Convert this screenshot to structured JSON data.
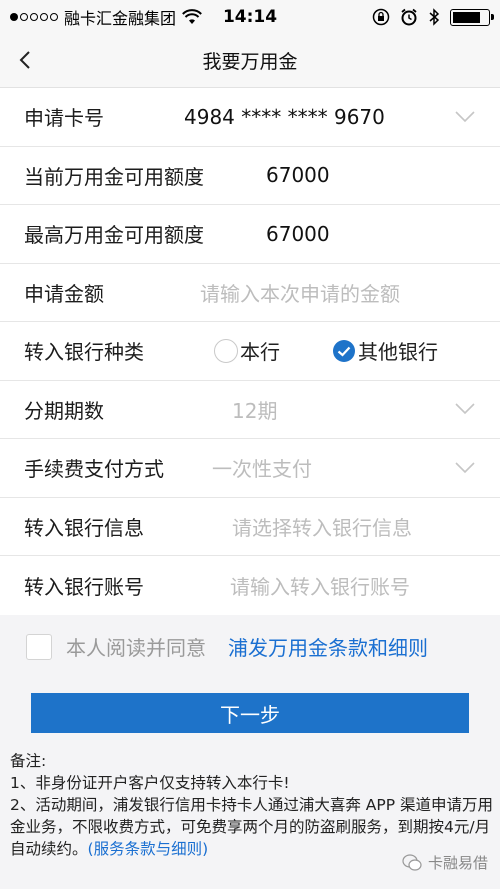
{
  "status_bar": {
    "carrier": "融卡汇金融集团",
    "time": "14:14",
    "battery_level": 0.8
  },
  "nav": {
    "title": "我要万用金"
  },
  "form": {
    "card_number": {
      "label": "申请卡号",
      "value": "4984 **** **** 9670"
    },
    "current_limit": {
      "label": "当前万用金可用额度",
      "value": "67000"
    },
    "max_limit": {
      "label": "最高万用金可用额度",
      "value": "67000"
    },
    "amount": {
      "label": "申请金额",
      "placeholder": "请输入本次申请的金额"
    },
    "bank_type": {
      "label": "转入银行种类",
      "options": [
        "本行",
        "其他银行"
      ],
      "selected": "其他银行"
    },
    "installments": {
      "label": "分期期数",
      "value": "12期"
    },
    "fee_method": {
      "label": "手续费支付方式",
      "value": "一次性支付"
    },
    "bank_info": {
      "label": "转入银行信息",
      "placeholder": "请选择转入银行信息"
    },
    "bank_account": {
      "label": "转入银行账号",
      "placeholder": "请输入转入银行账号"
    }
  },
  "agreement": {
    "text": "本人阅读并同意",
    "link": "浦发万用金条款和细则"
  },
  "next_button": "下一步",
  "notes": {
    "title": "备注:",
    "line1": "1、非身份证开户客户仅支持转入本行卡!",
    "line2": "2、活动期间，浦发银行信用卡持卡人通过浦大喜奔 APP 渠道申请万用金业务，不限收费方式，可免费享两个月的防盗刷服务，到期按4元/月自动续约。",
    "link": "(服务条款与细则)"
  },
  "watermark": "卡融易借",
  "colors": {
    "accent": "#1e73c9",
    "link": "#1a6fd1",
    "placeholder": "#bdbdbd"
  }
}
